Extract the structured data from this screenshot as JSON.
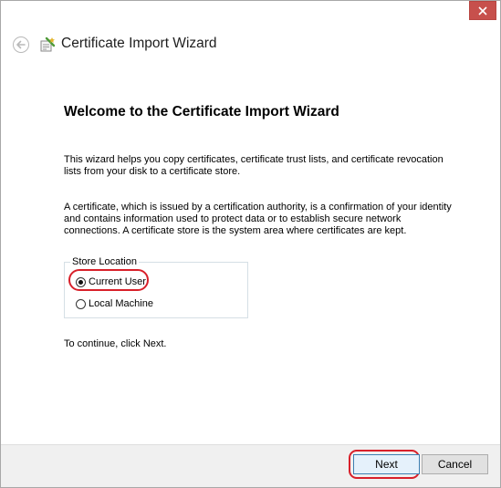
{
  "window": {
    "title": "Certificate Import Wizard"
  },
  "icons": {
    "close": "close-icon",
    "back": "back-arrow-icon",
    "wizard": "certificate-wizard-icon"
  },
  "content": {
    "heading": "Welcome to the Certificate Import Wizard",
    "paragraph1": "This wizard helps you copy certificates, certificate trust lists, and certificate revocation lists from your disk to a certificate store.",
    "paragraph2": "A certificate, which is issued by a certification authority, is a confirmation of your identity and contains information used to protect data or to establish secure network connections. A certificate store is the system area where certificates are kept.",
    "store_location": {
      "label": "Store Location",
      "options": [
        {
          "label": "Current User",
          "selected": true
        },
        {
          "label": "Local Machine",
          "selected": false
        }
      ]
    },
    "continue_text": "To continue, click Next."
  },
  "footer": {
    "next_label": "Next",
    "cancel_label": "Cancel"
  },
  "colors": {
    "highlight": "#d8202a",
    "close_button": "#c7504c"
  }
}
